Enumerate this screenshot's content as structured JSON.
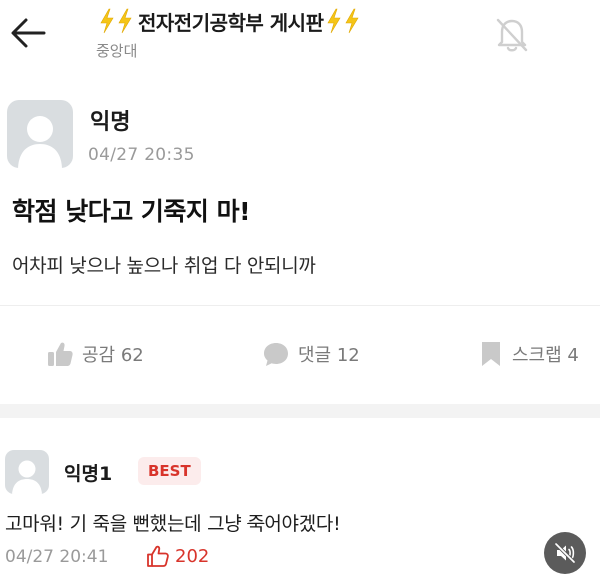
{
  "header": {
    "title": "전자전기공학부 게시판",
    "subtitle": "중앙대",
    "icons": {
      "back": "back-arrow-icon",
      "notification": "bell-off-icon",
      "decoration": "lightning-emoji-icon"
    }
  },
  "post": {
    "author": "익명",
    "date": "04/27 20:35",
    "title": "학점 낮다고 기죽지 마!",
    "body": "어차피 낮으나 높으나 취업 다 안되니까",
    "actions": {
      "like_label": "공감 62",
      "comment_label": "댓글 12",
      "scrap_label": "스크랩 4"
    }
  },
  "comment": {
    "author": "익명1",
    "badge": "BEST",
    "body_before": "고마워! 기 죽을 뻔했는데 그냥 ",
    "body_struck": "죽",
    "body_after": "어야겠다!",
    "date": "04/27 20:41",
    "likes": "202"
  },
  "colors": {
    "accent": "#d8342b",
    "bolt": "#f5c518",
    "muted": "#9a9a9a"
  },
  "overlay": {
    "icon": "mute-icon"
  }
}
